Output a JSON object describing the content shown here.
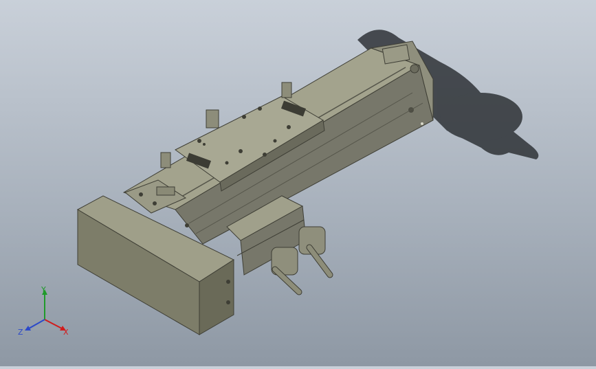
{
  "viewport": {
    "colors": {
      "background_top": "#c9d0d9",
      "background_bottom": "#8e98a4",
      "model_body": "#8a8a72",
      "model_top": "#a3a38d",
      "model_dark": "#55554a",
      "shadow": "#2f3337"
    },
    "model": "linear-actuator-with-motor",
    "shadow": "drop-shadow"
  },
  "triad": {
    "x_label": "X",
    "y_label": "Y",
    "z_label": "Z",
    "x_color": "#d11c1c",
    "y_color": "#1f9a2a",
    "z_color": "#2b49c9"
  }
}
